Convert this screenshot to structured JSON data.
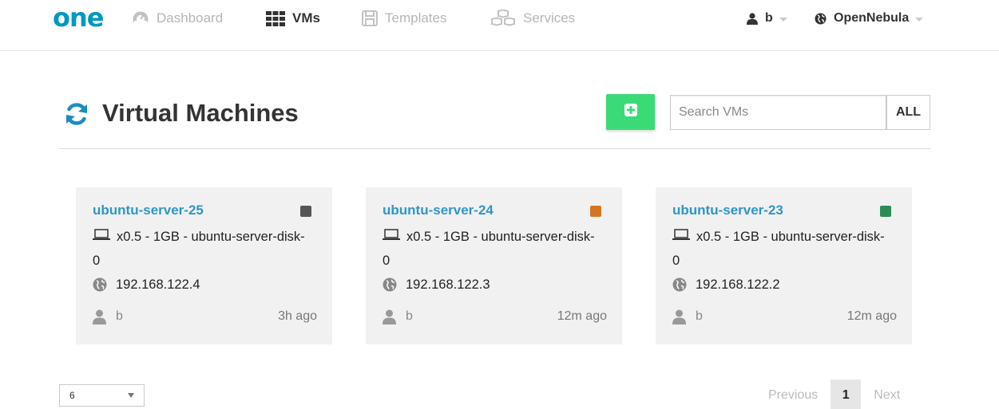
{
  "nav": {
    "logo": "one",
    "items": [
      {
        "label": "Dashboard",
        "icon": "dashboard-icon",
        "active": false
      },
      {
        "label": "VMs",
        "icon": "grid-icon",
        "active": true
      },
      {
        "label": "Templates",
        "icon": "floppy-icon",
        "active": false
      },
      {
        "label": "Services",
        "icon": "cubes-icon",
        "active": false
      }
    ],
    "user": {
      "label": "b",
      "icon": "user-icon"
    },
    "zone": {
      "label": "OpenNebula",
      "icon": "globe-icon"
    }
  },
  "header": {
    "title": "Virtual Machines",
    "refresh_icon": "refresh-icon",
    "add_icon": "plus-icon",
    "search_placeholder": "Search VMs",
    "search_value": "",
    "filter_label": "ALL"
  },
  "colors": {
    "brand": "#0098c3",
    "link": "#2f97c6",
    "add_button": "#3adb76",
    "state_poweroff": "#555555",
    "state_pending": "#d4761f",
    "state_running": "#2e8b57"
  },
  "vms": [
    {
      "name": "ubuntu-server-25",
      "state_color": "#555555",
      "spec": "x0.5 - 1GB - ubuntu-server-disk-0",
      "ip": "192.168.122.4",
      "owner": "b",
      "age": "3h ago"
    },
    {
      "name": "ubuntu-server-24",
      "state_color": "#d4761f",
      "spec": "x0.5 - 1GB - ubuntu-server-disk-0",
      "ip": "192.168.122.3",
      "owner": "b",
      "age": "12m ago"
    },
    {
      "name": "ubuntu-server-23",
      "state_color": "#2e8b57",
      "spec": "x0.5 - 1GB - ubuntu-server-disk-0",
      "ip": "192.168.122.2",
      "owner": "b",
      "age": "12m ago"
    }
  ],
  "pagination": {
    "page_size": "6",
    "previous_label": "Previous",
    "current_page": "1",
    "next_label": "Next"
  }
}
